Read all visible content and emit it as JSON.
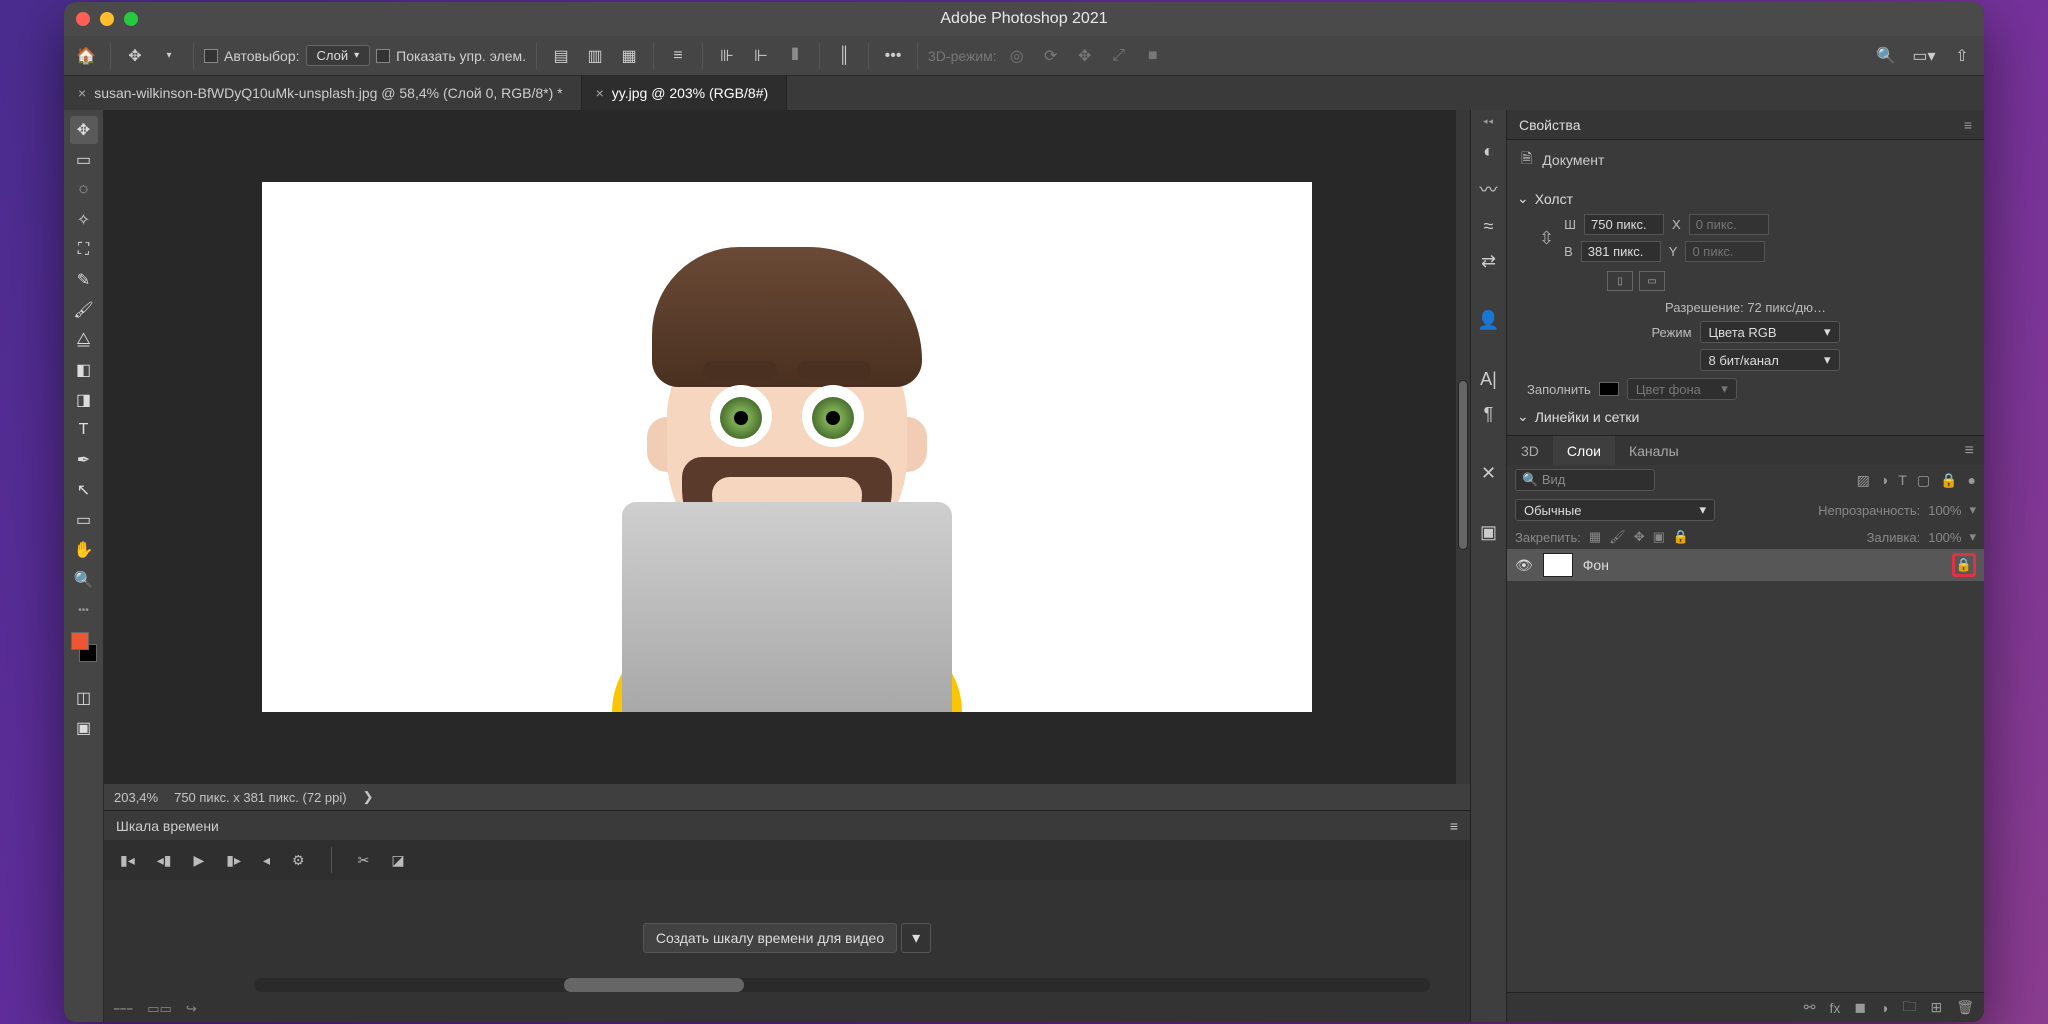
{
  "title": "Adobe Photoshop 2021",
  "optionsbar": {
    "auto_select": "Автовыбор:",
    "target": "Слой",
    "show_controls": "Показать упр. элем.",
    "mode3d": "3D-режим:"
  },
  "tabs": [
    {
      "label": "susan-wilkinson-BfWDyQ10uMk-unsplash.jpg @ 58,4% (Слой 0, RGB/8*) *",
      "active": false
    },
    {
      "label": "yy.jpg @ 203% (RGB/8#)",
      "active": true
    }
  ],
  "statusbar": {
    "zoom": "203,4%",
    "info": "750 пикс. x 381 пикс. (72 ppi)"
  },
  "timeline": {
    "title": "Шкала времени",
    "create_button": "Создать шкалу времени для видео"
  },
  "properties": {
    "title": "Свойства",
    "doc_label": "Документ",
    "canvas_section": "Холст",
    "w_label": "Ш",
    "w_value": "750 пикс.",
    "h_label": "В",
    "h_value": "381 пикс.",
    "x_label": "X",
    "x_placeholder": "0 пикс.",
    "y_label": "Y",
    "y_placeholder": "0 пикс.",
    "resolution": "Разрешение: 72 пикс/дю…",
    "mode_label": "Режим",
    "mode_value": "Цвета RGB",
    "depth_value": "8 бит/канал",
    "fill_label": "Заполнить",
    "fill_value": "Цвет фона",
    "rulers_section": "Линейки и сетки"
  },
  "layers": {
    "tabs": [
      "3D",
      "Слои",
      "Каналы"
    ],
    "search_placeholder": "Вид",
    "blend_value": "Обычные",
    "opacity_label": "Непрозрачность:",
    "opacity_value": "100%",
    "lock_label": "Закрепить:",
    "fill_label": "Заливка:",
    "fill_value": "100%",
    "layer_name": "Фон"
  }
}
